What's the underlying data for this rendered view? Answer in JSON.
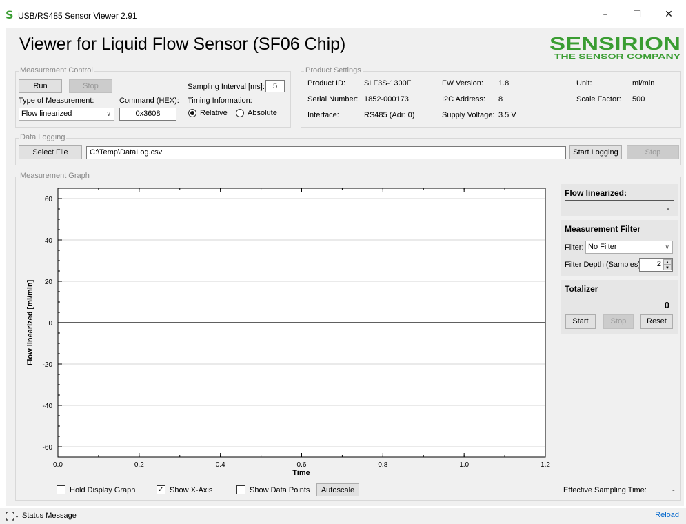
{
  "window": {
    "title": "USB/RS485 Sensor Viewer 2.91",
    "app_icon": "S",
    "minimize": "–",
    "maximize": "☐",
    "close": "✕"
  },
  "header": {
    "title": "Viewer for Liquid Flow Sensor (SF06 Chip)",
    "logo_top": "SENSIRION",
    "logo_bottom": "THE SENSOR COMPANY",
    "brand_color": "#3a9d32"
  },
  "measurement_control": {
    "label": "Measurement Control",
    "run": "Run",
    "stop": "Stop",
    "type_label": "Type of Measurement:",
    "type_value": "Flow linearized",
    "command_label": "Command (HEX):",
    "command_value": "0x3608",
    "sampling_label": "Sampling Interval [ms]:",
    "sampling_value": "5",
    "timing_label": "Timing Information:",
    "relative": "Relative",
    "absolute": "Absolute",
    "timing_selected": "Relative"
  },
  "product_settings": {
    "label": "Product Settings",
    "product_id_label": "Product ID:",
    "product_id": "SLF3S-1300F",
    "serial_label": "Serial Number:",
    "serial": "1852-000173",
    "interface_label": "Interface:",
    "interface": "RS485 (Adr: 0)",
    "fw_label": "FW Version:",
    "fw": "1.8",
    "i2c_label": "I2C Address:",
    "i2c": "8",
    "supply_label": "Supply Voltage:",
    "supply": "3.5 V",
    "unit_label": "Unit:",
    "unit": "ml/min",
    "scale_label": "Scale Factor:",
    "scale": "500"
  },
  "data_logging": {
    "label": "Data Logging",
    "select_file": "Select File",
    "path": "C:\\Temp\\DataLog.csv",
    "start": "Start Logging",
    "stop": "Stop"
  },
  "graph": {
    "label": "Measurement Graph",
    "hold": "Hold Display Graph",
    "show_x_axis": "Show X-Axis",
    "show_points": "Show Data Points",
    "autoscale": "Autoscale",
    "hold_checked": false,
    "show_x_axis_checked": true,
    "show_points_checked": false,
    "effective_label": "Effective Sampling Time:",
    "effective_value": "-"
  },
  "chart_data": {
    "type": "line",
    "xlabel": "Time",
    "ylabel": "Flow linearized [ml/min]",
    "xlim": [
      0,
      1.2
    ],
    "ylim": [
      -65,
      65
    ],
    "x_ticks": [
      "0.0",
      "0.2",
      "0.4",
      "0.6",
      "0.8",
      "1.0",
      "1.2"
    ],
    "y_ticks": [
      "60",
      "40",
      "20",
      "0",
      "-20",
      "-40",
      "-60"
    ],
    "grid": "horizontal",
    "series": [
      {
        "values": []
      }
    ],
    "x_axis_line_at": 0
  },
  "flow_panel": {
    "title": "Flow linearized:",
    "value": "-"
  },
  "filter_panel": {
    "title": "Measurement Filter",
    "filter_label": "Filter:",
    "filter_value": "No Filter",
    "depth_label": "Filter Depth (Samples):",
    "depth_value": "2"
  },
  "totalizer": {
    "title": "Totalizer",
    "value": "0",
    "start": "Start",
    "stop": "Stop",
    "reset": "Reset"
  },
  "status": {
    "message": "Status Message",
    "reload": "Reload"
  }
}
